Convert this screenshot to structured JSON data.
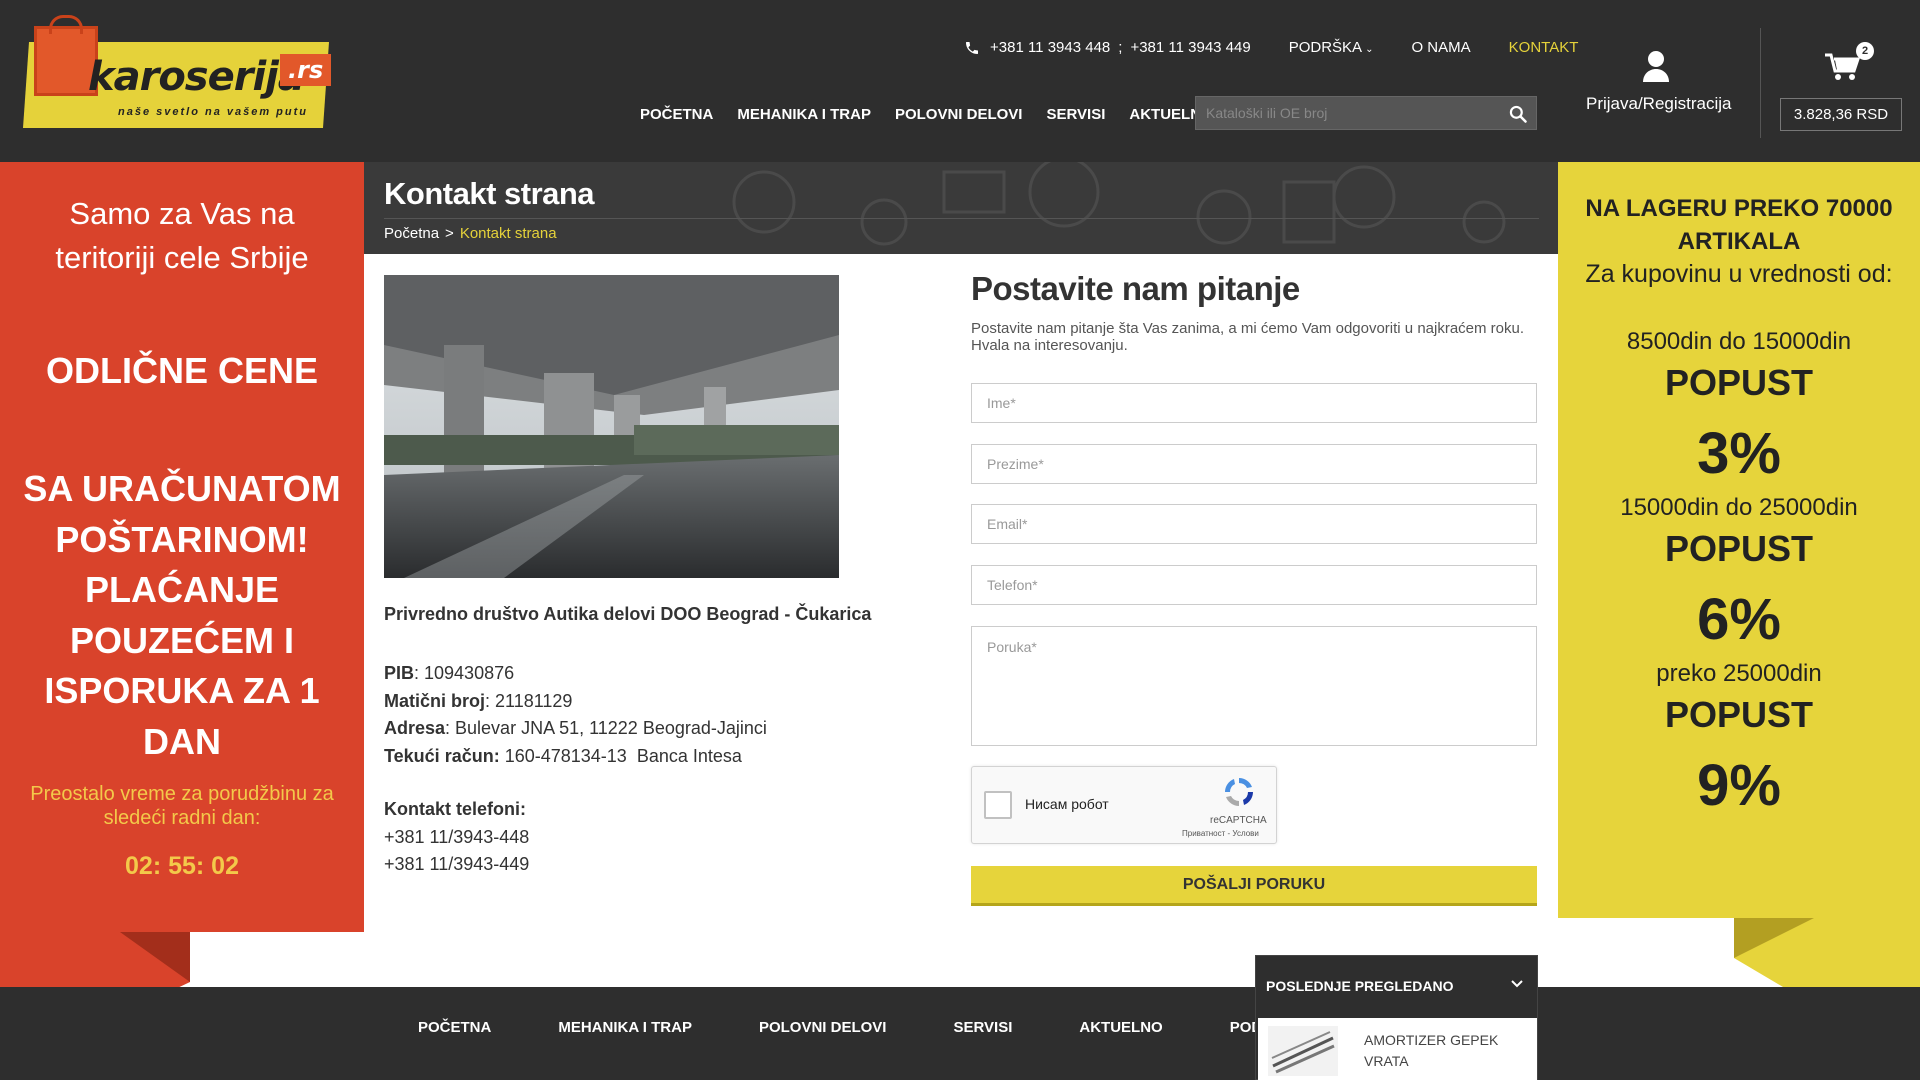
{
  "header": {
    "logo": {
      "word": "karoserija",
      "tld": ".rs",
      "tagline": "naše svetlo na vašem putu"
    },
    "phone1": "+381 11 3943 448",
    "phone_sep": ";",
    "phone2": "+381 11 3943 449",
    "top_links": {
      "support": "PODRŠKA",
      "about": "O NAMA",
      "contact": "KONTAKT"
    },
    "nav": [
      "POČETNA",
      "MEHANIKA I TRAP",
      "POLOVNI DELOVI",
      "SERVISI",
      "AKTUELNO"
    ],
    "search_placeholder": "Kataloški ili OE broj",
    "account_label": "Prijava/Registracija",
    "cart_count": "2",
    "cart_total": "3.828,36 RSD",
    "accent_color": "#e5d23a"
  },
  "left_promo": {
    "intro": "Samo za Vas na teritoriji cele Srbije",
    "headline1": "ODLIČNE CENE",
    "headline2": "SA URAČUNATOM POŠTARINOM! PLAĆANJE POUZEĆEM I ISPORUKA ZA 1 DAN",
    "remaining": "Preostalo vreme za porudžbinu za sledeći radni dan:",
    "timer": "02: 55: 02",
    "color": "#d9432b"
  },
  "right_promo": {
    "line1": "NA LAGERU PREKO 70000 ARTIKALA",
    "line2": "Za kupovinu u vrednosti od:",
    "tiers": [
      {
        "range": "8500din do 15000din",
        "label": "POPUST",
        "percent": "3%"
      },
      {
        "range": "15000din do 25000din",
        "label": "POPUST",
        "percent": "6%"
      },
      {
        "range": "preko 25000din",
        "label": "POPUST",
        "percent": "9%"
      }
    ],
    "color": "#e6d43b"
  },
  "page": {
    "title": "Kontakt strana",
    "breadcrumb": {
      "home": "Početna",
      "arrow": ">",
      "current": "Kontakt strana"
    }
  },
  "company": {
    "name": "Privredno društvo Autika delovi DOO Beograd - Čukarica",
    "pib_label": "PIB",
    "pib": ": 109430876",
    "mb_label": "Matični broj",
    "mb": ": 21181129",
    "address_label": "Adresa",
    "address": ": Bulevar JNA 51, 11222 Beograd-Jajinci",
    "account_label": "Tekući račun:",
    "account": " 160-478134-13  Banca Intesa",
    "phones_label": "Kontakt telefoni:",
    "phones": [
      "+381 11/3943-448",
      "+381 11/3943-449"
    ]
  },
  "form": {
    "title": "Postavite nam pitanje",
    "subtitle": "Postavite nam pitanje šta Vas zanima, a mi ćemo Vam odgovoriti u najkraćem roku. Hvala na interesovanju.",
    "first_name": "Ime*",
    "last_name": "Prezime*",
    "email": "Email*",
    "phone": "Telefon*",
    "message": "Poruka*",
    "captcha_label": "Нисам робот",
    "captcha_brand": "reCAPTCHA",
    "captcha_terms": "Приватност - Услови",
    "submit": "POŠALJI PORUKU"
  },
  "footer": {
    "nav": [
      "POČETNA",
      "MEHANIKA I TRAP",
      "POLOVNI DELOVI",
      "SERVISI",
      "AKTUELNO",
      "PODRŠKA"
    ]
  },
  "recently_viewed": {
    "title": "POSLEDNJE PREGLEDANO",
    "items": [
      {
        "name": "AMORTIZER GEPEK VRATA"
      }
    ]
  }
}
